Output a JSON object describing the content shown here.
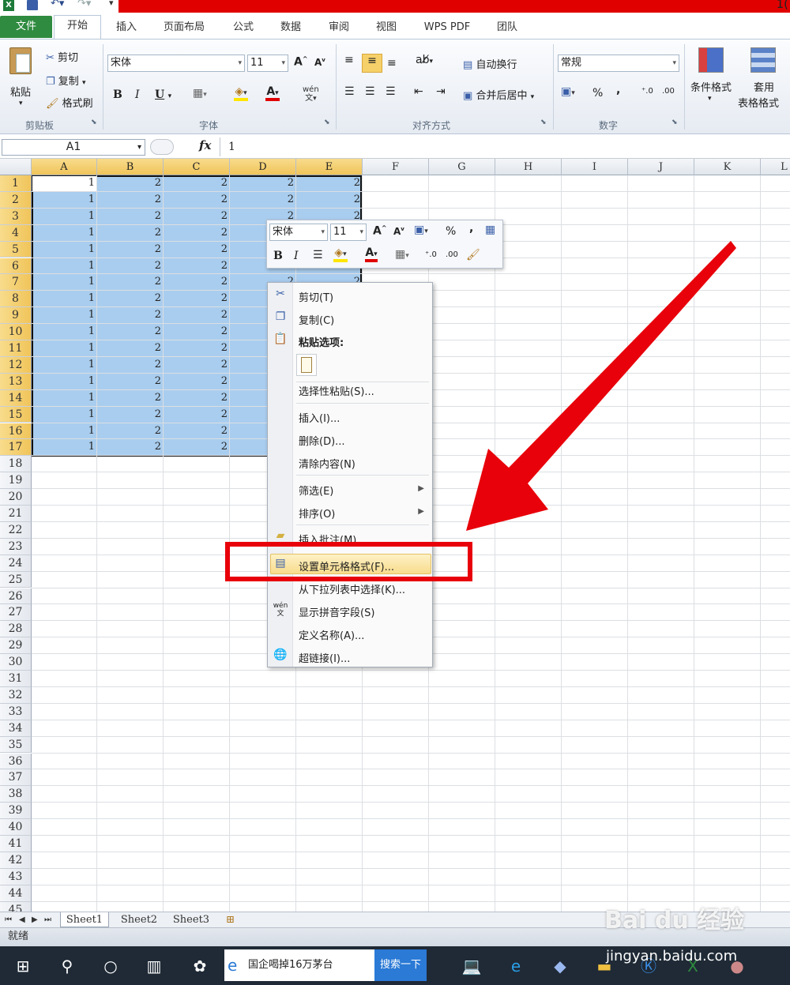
{
  "title_bar": {
    "right_text": "1("
  },
  "tabs": [
    "文件",
    "开始",
    "插入",
    "页面布局",
    "公式",
    "数据",
    "审阅",
    "视图",
    "WPS PDF",
    "团队"
  ],
  "ribbon": {
    "clipboard": {
      "paste": "粘贴",
      "cut": "剪切",
      "copy": "复制",
      "format_painter": "格式刷",
      "group": "剪贴板"
    },
    "font": {
      "name": "宋体",
      "size": "11",
      "group": "字体",
      "bold": "B",
      "italic": "I",
      "underline": "U"
    },
    "alignment": {
      "wrap": "自动换行",
      "merge": "合并后居中",
      "group": "对齐方式"
    },
    "number": {
      "format": "常规",
      "percent": "%",
      "comma": ",",
      "group": "数字"
    },
    "styles": {
      "conditional": "条件格式",
      "table_format_line1": "套用",
      "table_format_line2": "表格格式"
    }
  },
  "formula_bar": {
    "name_box": "A1",
    "fx": "fx",
    "value": "1"
  },
  "columns": [
    "A",
    "B",
    "C",
    "D",
    "E",
    "F",
    "G",
    "H",
    "I",
    "J",
    "K",
    "L"
  ],
  "rows": [
    "1",
    "2",
    "3",
    "4",
    "5",
    "6",
    "7",
    "8",
    "9",
    "10",
    "11",
    "12",
    "13",
    "14",
    "15",
    "16",
    "17",
    "18",
    "19",
    "20",
    "21",
    "22",
    "23",
    "24",
    "25",
    "26",
    "27",
    "28",
    "29",
    "30",
    "31",
    "32",
    "33",
    "34",
    "35",
    "36",
    "37",
    "38",
    "39",
    "40",
    "41",
    "42",
    "43",
    "44",
    "45"
  ],
  "cell_values": {
    "A": "1",
    "B": "2",
    "C": "2",
    "D": "2",
    "E": "2"
  },
  "mini_toolbar": {
    "font": "宋体",
    "size": "11",
    "percent": "%",
    "comma": ",",
    "bold": "B",
    "italic": "I"
  },
  "context_menu": {
    "cut": "剪切(T)",
    "copy": "复制(C)",
    "paste_options": "粘贴选项:",
    "paste_special": "选择性粘贴(S)...",
    "insert": "插入(I)...",
    "delete": "删除(D)...",
    "clear": "清除内容(N)",
    "filter": "筛选(E)",
    "sort": "排序(O)",
    "insert_comment": "插入批注(M)",
    "format_cells": "设置单元格格式(F)...",
    "pick_list": "从下拉列表中选择(K)...",
    "phonetic": "显示拼音字段(S)",
    "define_name": "定义名称(A)...",
    "hyperlink": "超链接(I)..."
  },
  "sheets": [
    "Sheet1",
    "Sheet2",
    "Sheet3"
  ],
  "status": "就绪",
  "taskbar": {
    "browser_title": "国企喝掉16万茅台",
    "search_btn": "搜索一下"
  },
  "watermark": {
    "brand": "Bai du 经验",
    "url": "jingyan.baidu.com"
  },
  "colors": {
    "selection": "#a9cdee",
    "highlight": "#e8000a",
    "file_tab": "#2e8b3f",
    "header_sel": "#f0c45a"
  }
}
